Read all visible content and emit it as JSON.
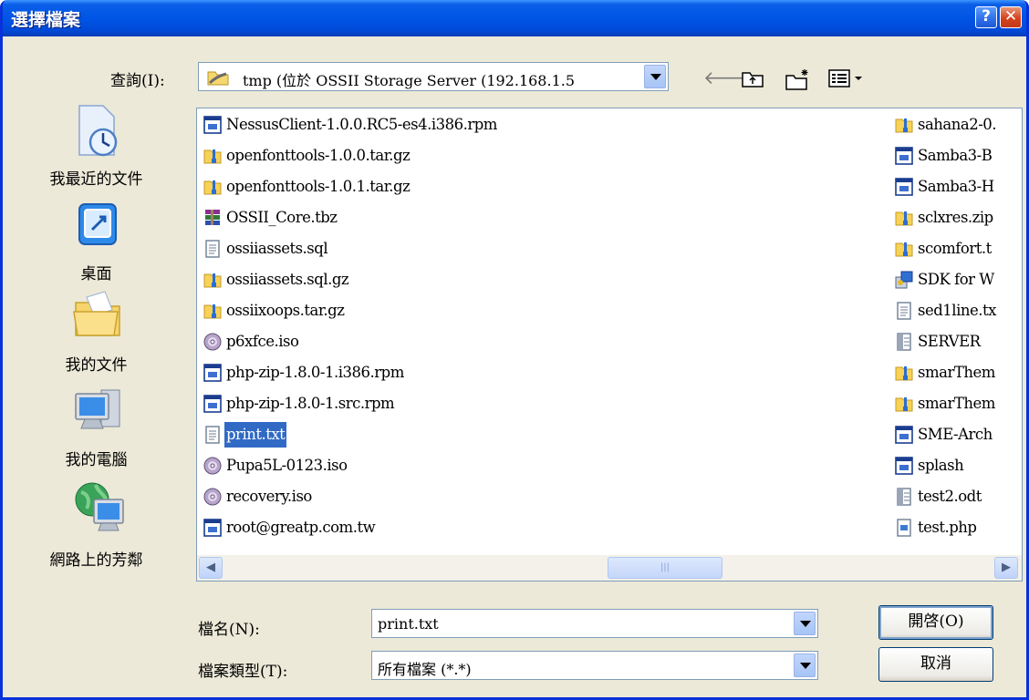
{
  "window": {
    "title": "選擇檔案",
    "help_label": "?",
    "close_label": "✕"
  },
  "lookin": {
    "label": "查詢(I):",
    "value": "tmp (位於 OSSII Storage Server (192.168.1.5"
  },
  "toolbar": {
    "back_icon": "back-arrow-icon",
    "up_icon": "up-folder-icon",
    "new_folder_icon": "new-folder-icon",
    "views_icon": "views-menu-icon"
  },
  "places": [
    {
      "label": "我最近的文件",
      "icon": "recent-documents-icon"
    },
    {
      "label": "桌面",
      "icon": "desktop-icon"
    },
    {
      "label": "我的文件",
      "icon": "my-documents-icon"
    },
    {
      "label": "我的電腦",
      "icon": "my-computer-icon"
    },
    {
      "label": "網路上的芳鄰",
      "icon": "network-places-icon"
    }
  ],
  "files_col1": [
    {
      "name": "NessusClient-1.0.0.RC5-es4.i386.rpm",
      "type": "file"
    },
    {
      "name": "openfonttools-1.0.0.tar.gz",
      "type": "archive"
    },
    {
      "name": "openfonttools-1.0.1.tar.gz",
      "type": "archive"
    },
    {
      "name": "OSSII_Core.tbz",
      "type": "rar"
    },
    {
      "name": "ossiiassets.sql",
      "type": "text"
    },
    {
      "name": "ossiiassets.sql.gz",
      "type": "archive"
    },
    {
      "name": "ossiixoops.tar.gz",
      "type": "archive"
    },
    {
      "name": "p6xfce.iso",
      "type": "disc"
    },
    {
      "name": "php-zip-1.8.0-1.i386.rpm",
      "type": "file"
    },
    {
      "name": "php-zip-1.8.0-1.src.rpm",
      "type": "file"
    },
    {
      "name": "print.txt",
      "type": "text",
      "selected": true
    },
    {
      "name": "Pupa5L-0123.iso",
      "type": "disc"
    },
    {
      "name": "recovery.iso",
      "type": "disc"
    },
    {
      "name": "root@greatp.com.tw",
      "type": "file"
    }
  ],
  "files_col2": [
    {
      "name": "sahana2-0.",
      "type": "archive"
    },
    {
      "name": "Samba3-B",
      "type": "file"
    },
    {
      "name": "Samba3-H",
      "type": "file"
    },
    {
      "name": "sclxres.zip",
      "type": "archive"
    },
    {
      "name": "scomfort.t",
      "type": "archive"
    },
    {
      "name": "SDK for W",
      "type": "installer"
    },
    {
      "name": "sed1line.tx",
      "type": "text"
    },
    {
      "name": "SERVER",
      "type": "doc"
    },
    {
      "name": "smarThem",
      "type": "archive"
    },
    {
      "name": "smarThem",
      "type": "archive"
    },
    {
      "name": "SME-Arch",
      "type": "file"
    },
    {
      "name": "splash",
      "type": "file"
    },
    {
      "name": "test2.odt",
      "type": "doc"
    },
    {
      "name": "test.php",
      "type": "php"
    }
  ],
  "scrollbar": {
    "left_arrow": "◀",
    "right_arrow": "▶",
    "grip": "|||"
  },
  "filename": {
    "label": "檔名(N):",
    "value": "print.txt"
  },
  "filetype": {
    "label": "檔案類型(T):",
    "value": "所有檔案 (*.*)"
  },
  "buttons": {
    "open": "開啓(O)",
    "cancel": "取消"
  }
}
